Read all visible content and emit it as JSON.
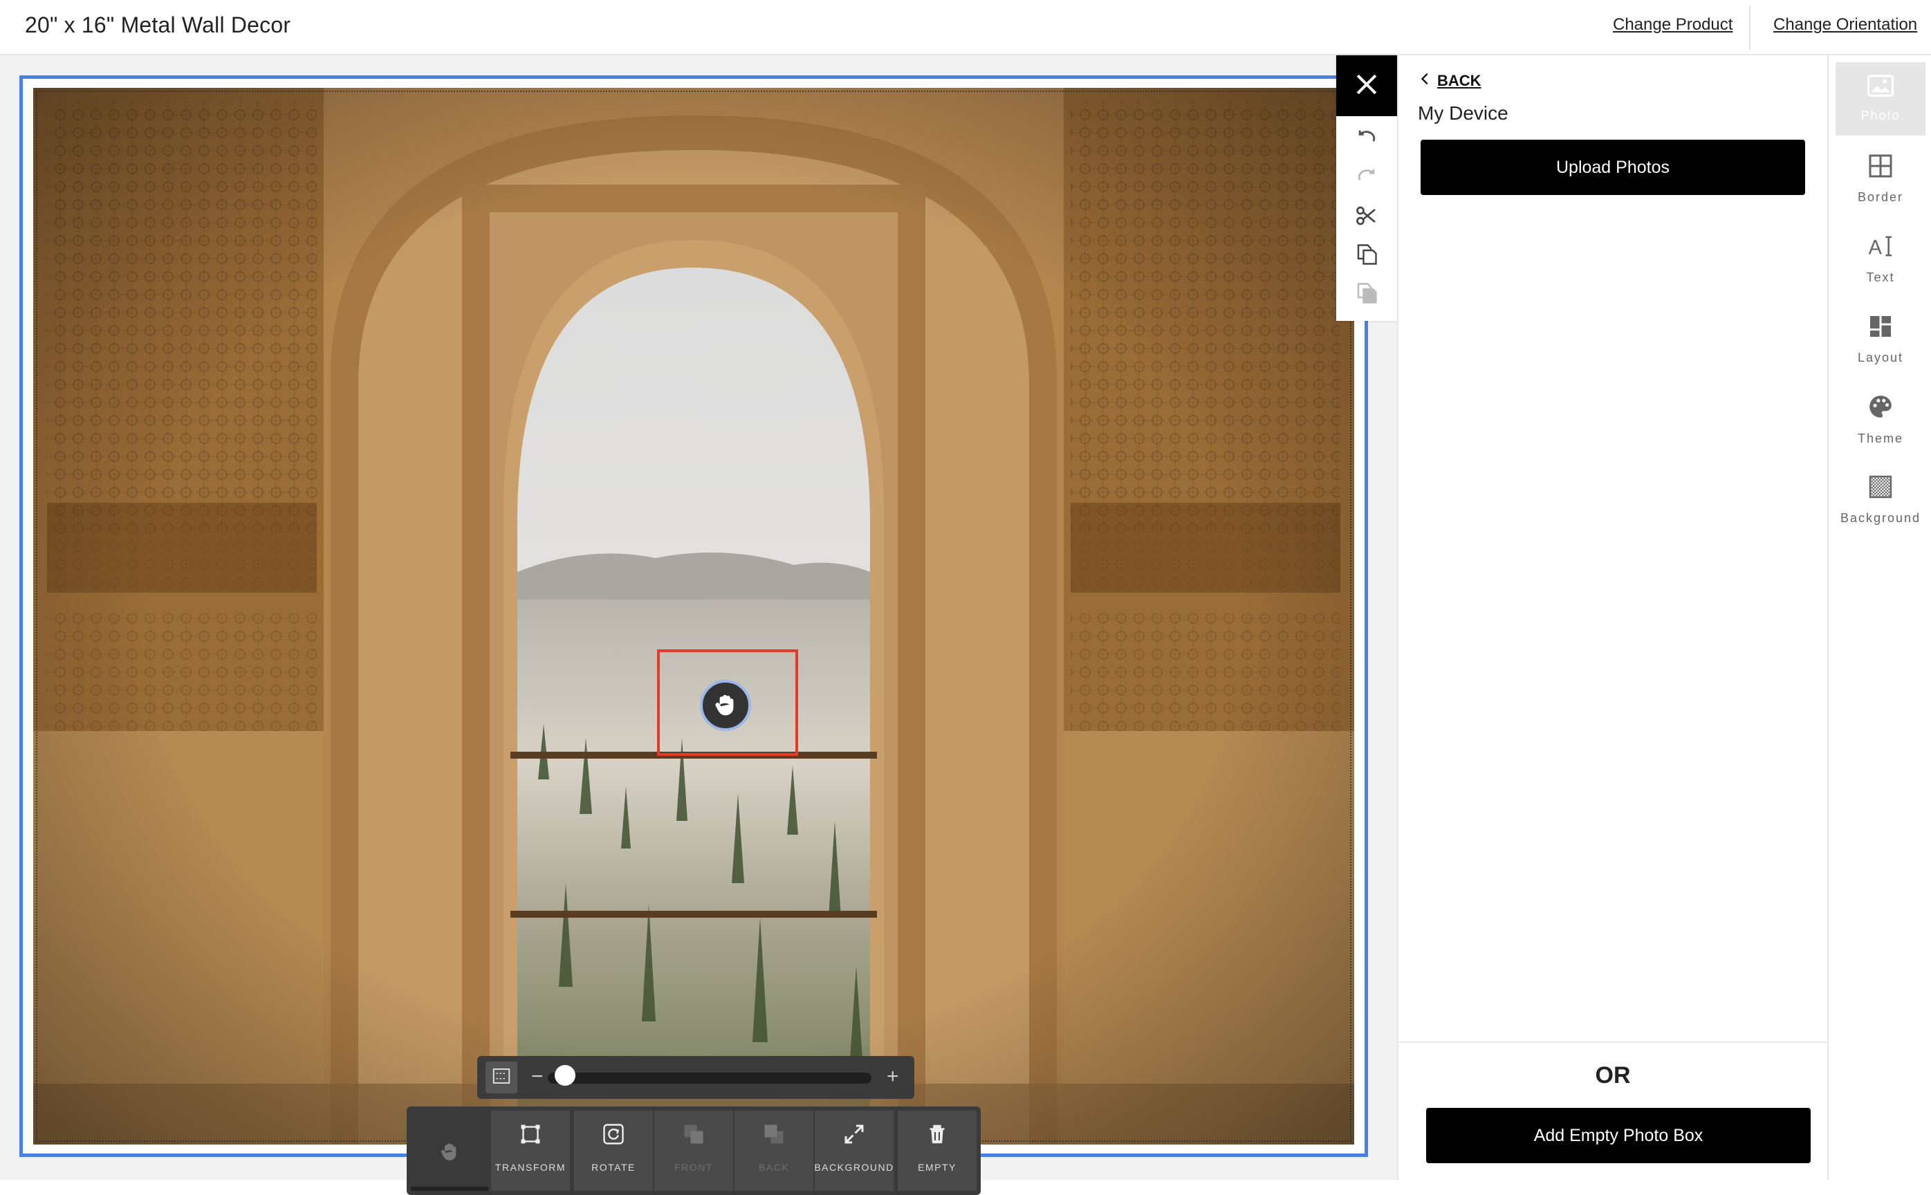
{
  "header": {
    "title": "20\" x 16\" Metal Wall Decor",
    "change_product": "Change Product",
    "change_orientation": "Change Orientation"
  },
  "icons": {
    "close": "close-icon",
    "undo": "undo-icon",
    "redo": "redo-icon",
    "cut": "scissors-icon",
    "copy": "copy-icon",
    "paste": "paste-icon",
    "hand": "hand-icon",
    "back": "chevron-left-icon"
  },
  "zoom": {
    "minus": "−",
    "plus": "+",
    "level": 0
  },
  "toolbar": {
    "tools": [
      {
        "label": "",
        "icon": "hand-icon",
        "enabled": true
      },
      {
        "label": "TRANSFORM",
        "icon": "transform-icon",
        "enabled": true
      },
      {
        "label": "ROTATE",
        "icon": "rotate-icon",
        "enabled": true
      },
      {
        "label": "FRONT",
        "icon": "bring-front-icon",
        "enabled": false
      },
      {
        "label": "BACK",
        "icon": "send-back-icon",
        "enabled": false
      },
      {
        "label": "BACKGROUND",
        "icon": "expand-icon",
        "enabled": true
      },
      {
        "label": "EMPTY",
        "icon": "trash-icon",
        "enabled": true
      }
    ]
  },
  "panel": {
    "back_label": "BACK",
    "source_title": "My Device",
    "upload_button": "Upload Photos",
    "or_text": "OR",
    "add_empty_button": "Add Empty Photo Box"
  },
  "side_nav": {
    "items": [
      {
        "label": "Photo",
        "icon": "photo-icon",
        "active": true
      },
      {
        "label": "Border",
        "icon": "border-grid-icon",
        "active": false
      },
      {
        "label": "Text",
        "icon": "text-icon",
        "active": false
      },
      {
        "label": "Layout",
        "icon": "layout-icon",
        "active": false
      },
      {
        "label": "Theme",
        "icon": "palette-icon",
        "active": false
      },
      {
        "label": "Background",
        "icon": "background-pattern-icon",
        "active": false
      }
    ]
  },
  "colors": {
    "frame_border": "#4a7fe6",
    "selection": "#e23b2b",
    "button_bg": "#000000",
    "toolbar_bg": "#3a3a3a"
  }
}
